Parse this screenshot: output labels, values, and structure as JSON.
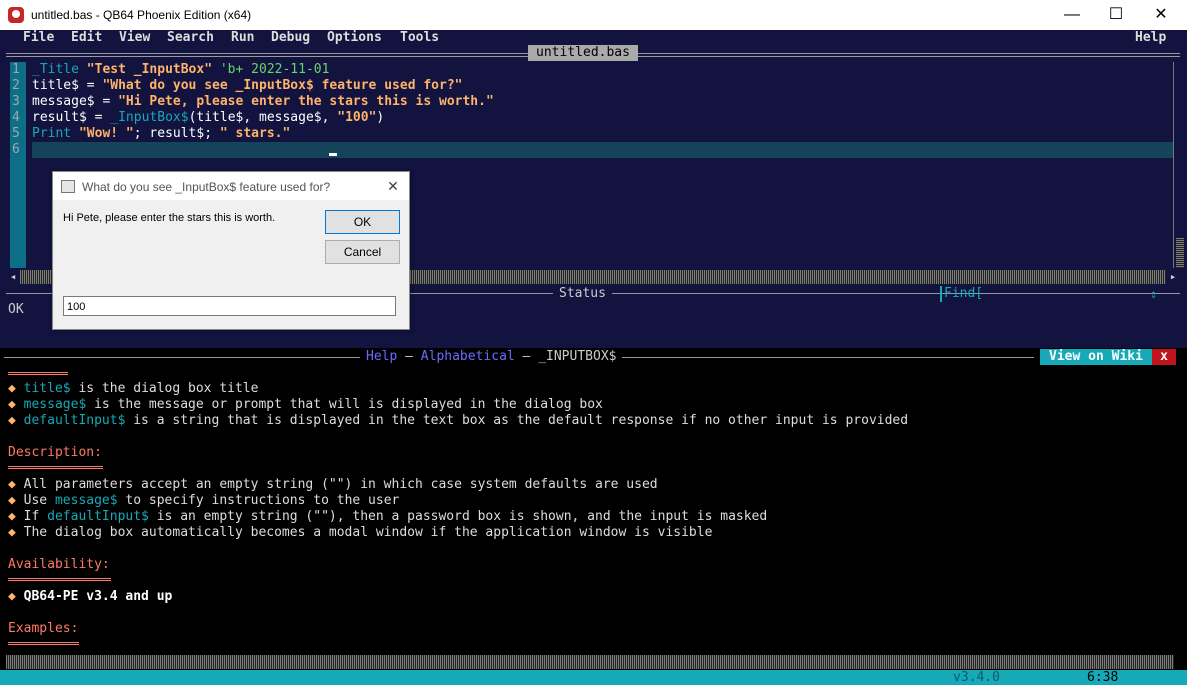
{
  "window": {
    "title": "untitled.bas - QB64 Phoenix Edition (x64)",
    "minimize": "—",
    "maximize": "☐",
    "close": "✕"
  },
  "menu": {
    "items": [
      "File",
      "Edit",
      "View",
      "Search",
      "Run",
      "Debug",
      "Options",
      "Tools"
    ],
    "help": "Help"
  },
  "editor": {
    "tab": "untitled.bas",
    "line_numbers": [
      "1",
      "2",
      "3",
      "4",
      "5",
      "6"
    ],
    "lines": [
      [
        {
          "t": "_Title ",
          "c": "kw"
        },
        {
          "t": "\"Test _InputBox\"",
          "c": "str"
        },
        {
          "t": " 'b+ 2022-11-01",
          "c": "cmt"
        }
      ],
      [
        {
          "t": "title$ = ",
          "c": "wht"
        },
        {
          "t": "\"What do you see _InputBox$ feature used for?\"",
          "c": "str"
        }
      ],
      [
        {
          "t": "message$ = ",
          "c": "wht"
        },
        {
          "t": "\"Hi Pete, please enter the stars this is worth.\"",
          "c": "str"
        }
      ],
      [
        {
          "t": "result$ = ",
          "c": "wht"
        },
        {
          "t": "_InputBox$",
          "c": "kw"
        },
        {
          "t": "(title$, message$, ",
          "c": "wht"
        },
        {
          "t": "\"100\"",
          "c": "str"
        },
        {
          "t": ")",
          "c": "wht"
        }
      ],
      [
        {
          "t": "Print ",
          "c": "kw"
        },
        {
          "t": "\"Wow! \"",
          "c": "str"
        },
        {
          "t": "; result$; ",
          "c": "wht"
        },
        {
          "t": "\" stars.\"",
          "c": "str"
        }
      ],
      []
    ]
  },
  "status": {
    "label": "Status",
    "text": "OK",
    "find_label": "Find[",
    "find_arrows": "⇕"
  },
  "help": {
    "header_prefix": "Help",
    "header_link": "Alphabetical",
    "header_sep": " – ",
    "header_topic": "_INPUTBOX$",
    "view_on_wiki": "View on Wiki",
    "close": "x",
    "params": [
      {
        "kw": "title$",
        "rest": " is the dialog box title"
      },
      {
        "kw": "message$",
        "rest": " is the message or prompt that will is displayed in the dialog box"
      },
      {
        "kw": "defaultInput$",
        "rest": " is a string that is displayed in the text box as the default response if no other input is provided"
      }
    ],
    "description_heading": "Description:",
    "description": [
      {
        "pre": "All parameters accept an empty string (\"\") in which case system defaults are used",
        "kw": "",
        "post": ""
      },
      {
        "pre": "Use ",
        "kw": "message$",
        "post": " to specify instructions to the user"
      },
      {
        "pre": "If ",
        "kw": "defaultInput$",
        "post": " is an empty string (\"\"), then a password box is shown, and the input is masked"
      },
      {
        "pre": "The dialog box automatically becomes a modal window if the application window is visible",
        "kw": "",
        "post": ""
      }
    ],
    "availability_heading": "Availability:",
    "availability": "QB64-PE v3.4 and up",
    "examples_heading": "Examples:",
    "bullet": "◆"
  },
  "bottom": {
    "version": "v3.4.0",
    "clock": "6:38"
  },
  "dialog": {
    "title": "What do you see _InputBox$ feature used for?",
    "message": "Hi Pete, please enter the stars this is worth.",
    "ok": "OK",
    "cancel": "Cancel",
    "input_value": "100",
    "close": "✕"
  }
}
